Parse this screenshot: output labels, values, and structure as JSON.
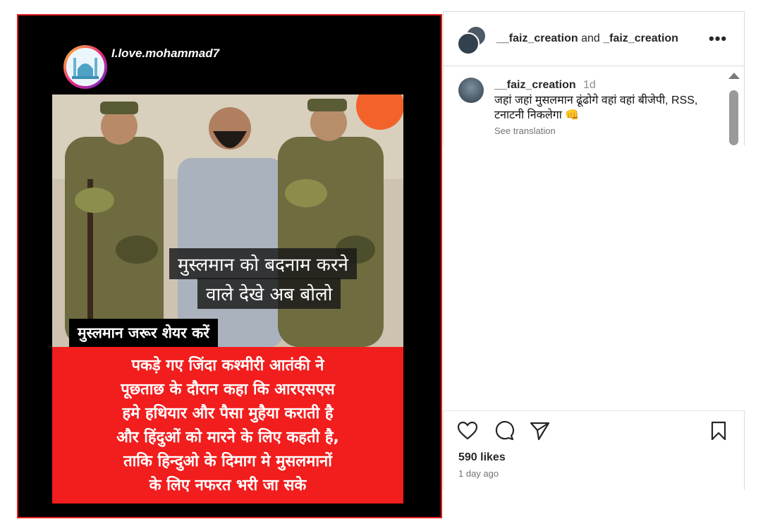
{
  "media": {
    "poster_handle": "I.love.mohammad7",
    "caption_line1": "मुस्लमान को बदनाम करने",
    "caption_line2": "वाले देखे अब बोलो",
    "share_strip": "मुस्लमान जरूर शेयर करें",
    "red_lines": [
      "पकड़े गए जिंदा कश्मीरी आतंकी ने",
      "पूछताछ के दौरान कहा कि आरएसएस",
      "हमे हथियार और पैसा मुहैया कराती है",
      "और हिंदुओं को मारने के लिए कहती है,",
      "ताकि हिन्दुओ के दिमाग मे मुसलमानों",
      "के लिए नफरत भरी जा सके"
    ]
  },
  "header": {
    "user1": "__faiz_creation",
    "joiner": "and",
    "user2": "_faiz_creation",
    "more": "•••"
  },
  "comment": {
    "username": "__faiz_creation",
    "time": "1d",
    "text": "जहां जहां मुसलमान ढूंढोगे वहां वहां बीजेपी, RSS, टनाटनी निकलेगा 👊",
    "see_translation": "See translation"
  },
  "footer": {
    "likes": "590 likes",
    "time_ago": "1 day ago"
  },
  "icons": {
    "like": "heart-icon",
    "comment": "comment-icon",
    "share": "send-icon",
    "save": "bookmark-icon",
    "more": "more-icon"
  },
  "colors": {
    "red_panel": "#f21d1d",
    "media_border": "#e21d1d",
    "muted_text": "#737373"
  }
}
